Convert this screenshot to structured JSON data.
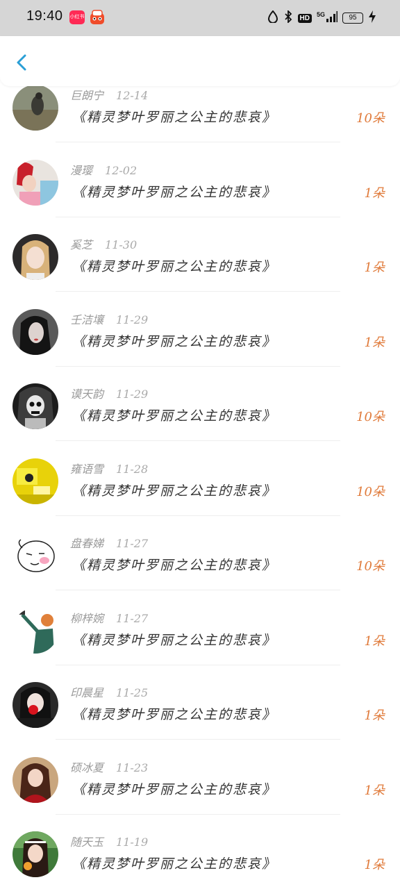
{
  "status_bar": {
    "time": "19:40",
    "app_badge_label": "小红书",
    "network": "5G",
    "hd_label": "HD",
    "battery": "95"
  },
  "header": {
    "back_icon": "chevron-left-icon",
    "accent_color": "#2a9fd6"
  },
  "list": {
    "qty_color": "#e07a3a",
    "items": [
      {
        "name": "巨朗宁",
        "date": "12-14",
        "gift": "《精灵梦叶罗丽之公主的悲哀》",
        "qty": "10朵"
      },
      {
        "name": "漫璎",
        "date": "12-02",
        "gift": "《精灵梦叶罗丽之公主的悲哀》",
        "qty": "1朵"
      },
      {
        "name": "奚芝",
        "date": "11-30",
        "gift": "《精灵梦叶罗丽之公主的悲哀》",
        "qty": "1朵"
      },
      {
        "name": "壬洁壤",
        "date": "11-29",
        "gift": "《精灵梦叶罗丽之公主的悲哀》",
        "qty": "1朵"
      },
      {
        "name": "谟天韵",
        "date": "11-29",
        "gift": "《精灵梦叶罗丽之公主的悲哀》",
        "qty": "10朵"
      },
      {
        "name": "雍语雪",
        "date": "11-28",
        "gift": "《精灵梦叶罗丽之公主的悲哀》",
        "qty": "10朵"
      },
      {
        "name": "盘春娣",
        "date": "11-27",
        "gift": "《精灵梦叶罗丽之公主的悲哀》",
        "qty": "10朵"
      },
      {
        "name": "柳梓婉",
        "date": "11-27",
        "gift": "《精灵梦叶罗丽之公主的悲哀》",
        "qty": "1朵"
      },
      {
        "name": "印晨星",
        "date": "11-25",
        "gift": "《精灵梦叶罗丽之公主的悲哀》",
        "qty": "1朵"
      },
      {
        "name": "硕冰夏",
        "date": "11-23",
        "gift": "《精灵梦叶罗丽之公主的悲哀》",
        "qty": "1朵"
      },
      {
        "name": "随天玉",
        "date": "11-19",
        "gift": "《精灵梦叶罗丽之公主的悲哀》",
        "qty": "1朵"
      }
    ]
  }
}
